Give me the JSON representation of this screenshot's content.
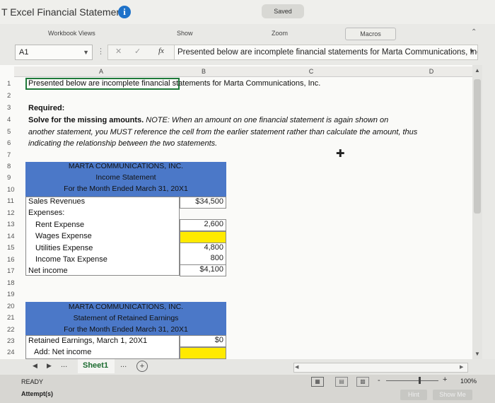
{
  "app": {
    "title": "T Excel Financial Statements",
    "saved_label": "Saved"
  },
  "ribbon": {
    "workbook_views": "Workbook Views",
    "show": "Show",
    "zoom": "Zoom",
    "macros": "Macros"
  },
  "formula_bar": {
    "name_box": "A1",
    "formula": "Presented below are incomplete financial statements for Marta Communications, Inc."
  },
  "columns": [
    "A",
    "B",
    "C",
    "D"
  ],
  "rows": [
    {
      "n": "1",
      "a": "Presented below are incomplete financial statements for Marta Communications, Inc."
    },
    {
      "n": "2",
      "a": ""
    },
    {
      "n": "3",
      "a": "Required:"
    },
    {
      "n": "4",
      "a_bold": "Solve for the missing amounts. ",
      "a_ital": "NOTE:  When an amount on one financial statement is again shown on"
    },
    {
      "n": "5",
      "a": "another statement, you MUST reference the cell from the earlier statement rather than calculate the amount, thus"
    },
    {
      "n": "6",
      "a": "indicating the relationship between the two statements."
    },
    {
      "n": "7"
    },
    {
      "n": "8"
    },
    {
      "n": "9"
    },
    {
      "n": "10"
    },
    {
      "n": "11"
    },
    {
      "n": "12"
    },
    {
      "n": "13"
    },
    {
      "n": "14"
    },
    {
      "n": "15"
    },
    {
      "n": "16"
    },
    {
      "n": "17"
    },
    {
      "n": "18"
    },
    {
      "n": "19"
    },
    {
      "n": "20"
    },
    {
      "n": "21"
    },
    {
      "n": "22"
    },
    {
      "n": "23"
    },
    {
      "n": "24"
    }
  ],
  "income_statement": {
    "company": "MARTA COMMUNICATIONS, INC.",
    "title": "Income Statement",
    "period": "For the Month Ended March 31, 20X1",
    "sales_label": "Sales Revenues",
    "sales_value": "$34,500",
    "expenses_label": "Expenses:",
    "rent_label": "Rent Expense",
    "rent_value": "2,600",
    "wages_label": "Wages Expense",
    "wages_value": "",
    "utilities_label": "Utilities Expense",
    "utilities_value": "4,800",
    "tax_label": "Income Tax Expense",
    "tax_value": "800",
    "net_label": "Net income",
    "net_value": "$4,100"
  },
  "retained_earnings": {
    "company": "MARTA COMMUNICATIONS, INC.",
    "title": "Statement of Retained Earnings",
    "period": "For the Month Ended March 31, 20X1",
    "re_label": "Retained Earnings, March 1, 20X1",
    "re_value": "$0",
    "add_label": "Add: Net income",
    "add_value": ""
  },
  "sheet_tabs": {
    "active": "Sheet1",
    "more": "...",
    "add": "+"
  },
  "status": {
    "ready": "READY",
    "attempts": "Attempt(s)",
    "zoom": "100%",
    "hint": "Hint",
    "show_me": "Show Me"
  },
  "colors": {
    "band": "#4b78c8",
    "highlight": "#ffea00",
    "info": "#1e72c9"
  }
}
